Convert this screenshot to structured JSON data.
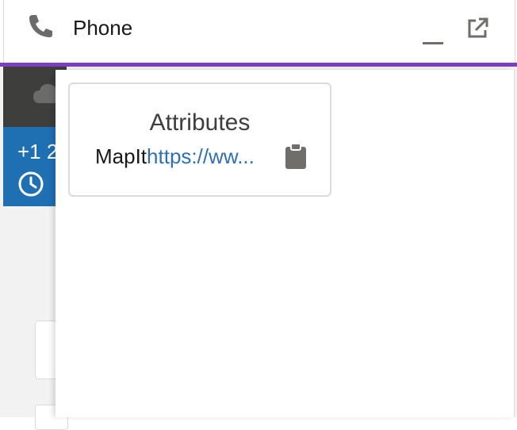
{
  "header": {
    "title": "Phone",
    "icons": {
      "phone": "phone-icon",
      "minimize": "minimize-icon",
      "popout": "popout-icon"
    },
    "accent_color": "#7b3fbf"
  },
  "background": {
    "number_text": "+1 2"
  },
  "attributes": {
    "title": "Attributes",
    "items": [
      {
        "name": "MapIt",
        "value": "https://ww..."
      }
    ],
    "copy_icon": "clipboard-icon",
    "link_color": "#2e6fb4"
  }
}
